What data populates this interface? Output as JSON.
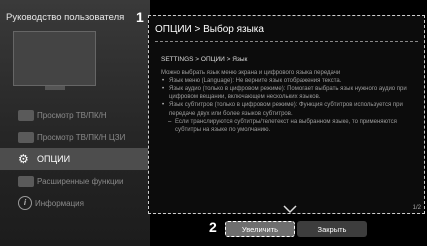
{
  "sidebar": {
    "title": "Руководство пользователя",
    "items": [
      {
        "label": "Просмотр ТВ/ПК/Н",
        "icon": "tv-icon"
      },
      {
        "label": "Просмотр ТВ/ПК/Н ЦЗИ",
        "icon": "tv-icon"
      },
      {
        "label": "ОПЦИИ",
        "icon": "gear-icon"
      },
      {
        "label": "Расширенные функции",
        "icon": "feature-icon"
      },
      {
        "label": "Информация",
        "icon": "info-icon"
      }
    ]
  },
  "callouts": {
    "one": "1",
    "two": "2"
  },
  "panel": {
    "header": "ОПЦИИ > Выбор языка",
    "article": {
      "heading": "SETTINGS > ОПЦИИ > Язык",
      "intro": "Можно выбрать язык меню экрана и цифрового языка передачи",
      "bullets": [
        "Язык меню (Language): Не верните язык отображения текста.",
        "Язык аудио (только в цифровом режиме): Помогает выбрать язык нужного аудио при цифровом вещании, включающем нескольких языков.",
        "Язык субтитров (только в цифровом режиме): Функция субтитров используется при передаче двух или более языков субтитров."
      ],
      "sub_bullets": [
        "Если транслируются субтитры/телетекст на выбранном языке, то применяются субтитры на языке по умолчанию."
      ]
    },
    "page": "1/2"
  },
  "buttons": {
    "enlarge": "Увеличить",
    "close": "Закрыть"
  },
  "colors": {
    "background": "#000000",
    "panel": "#0c0c0c",
    "accent": "#6e6e6e"
  }
}
